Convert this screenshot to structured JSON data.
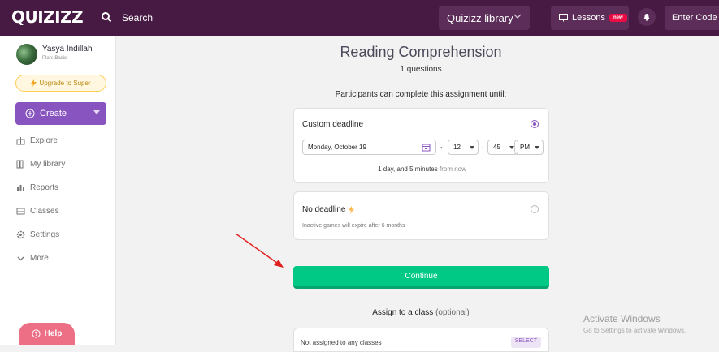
{
  "topbar": {
    "logo": "QUIZIZZ",
    "search_label": "Search",
    "library_select": "Quizizz library",
    "lessons_label": "Lessons",
    "lessons_badge": "new",
    "enter_code_label": "Enter Code"
  },
  "sidebar": {
    "user_name": "Yasya Indillah",
    "user_plan": "Plan: Basic",
    "upgrade_label": "Upgrade to Super",
    "create_label": "Create",
    "nav": [
      {
        "label": "Explore",
        "icon": "explore-icon"
      },
      {
        "label": "My library",
        "icon": "library-icon"
      },
      {
        "label": "Reports",
        "icon": "reports-icon"
      },
      {
        "label": "Classes",
        "icon": "classes-icon"
      },
      {
        "label": "Settings",
        "icon": "gear-icon"
      },
      {
        "label": "More",
        "icon": "chevron-down-icon"
      }
    ],
    "help_label": "Help"
  },
  "main": {
    "title": "Reading Comprehension",
    "subtitle": "1 questions",
    "participants_text": "Participants can complete this assignment until:",
    "custom_deadline": {
      "title": "Custom deadline",
      "date": "Monday, October 19",
      "hour": "12",
      "minute": "45",
      "ampm": "PM",
      "from_now_bold": "1 day, and 5 minutes",
      "from_now_rest": "from now"
    },
    "no_deadline": {
      "title": "No deadline",
      "note": "Inactive games will expire after 6 months"
    },
    "continue_label": "Continue",
    "assign_label": "Assign to a class",
    "assign_optional": "(optional)",
    "class_box_text": "Not assigned to any classes",
    "select_label": "SELECT"
  },
  "overlay": {
    "activate_title": "Activate Windows",
    "activate_sub": "Go to Settings to activate Windows."
  },
  "colors": {
    "topbar": "#461a42",
    "primary": "#8854c0",
    "continue": "#00c985",
    "annotation_arrow": "#e0201e"
  }
}
